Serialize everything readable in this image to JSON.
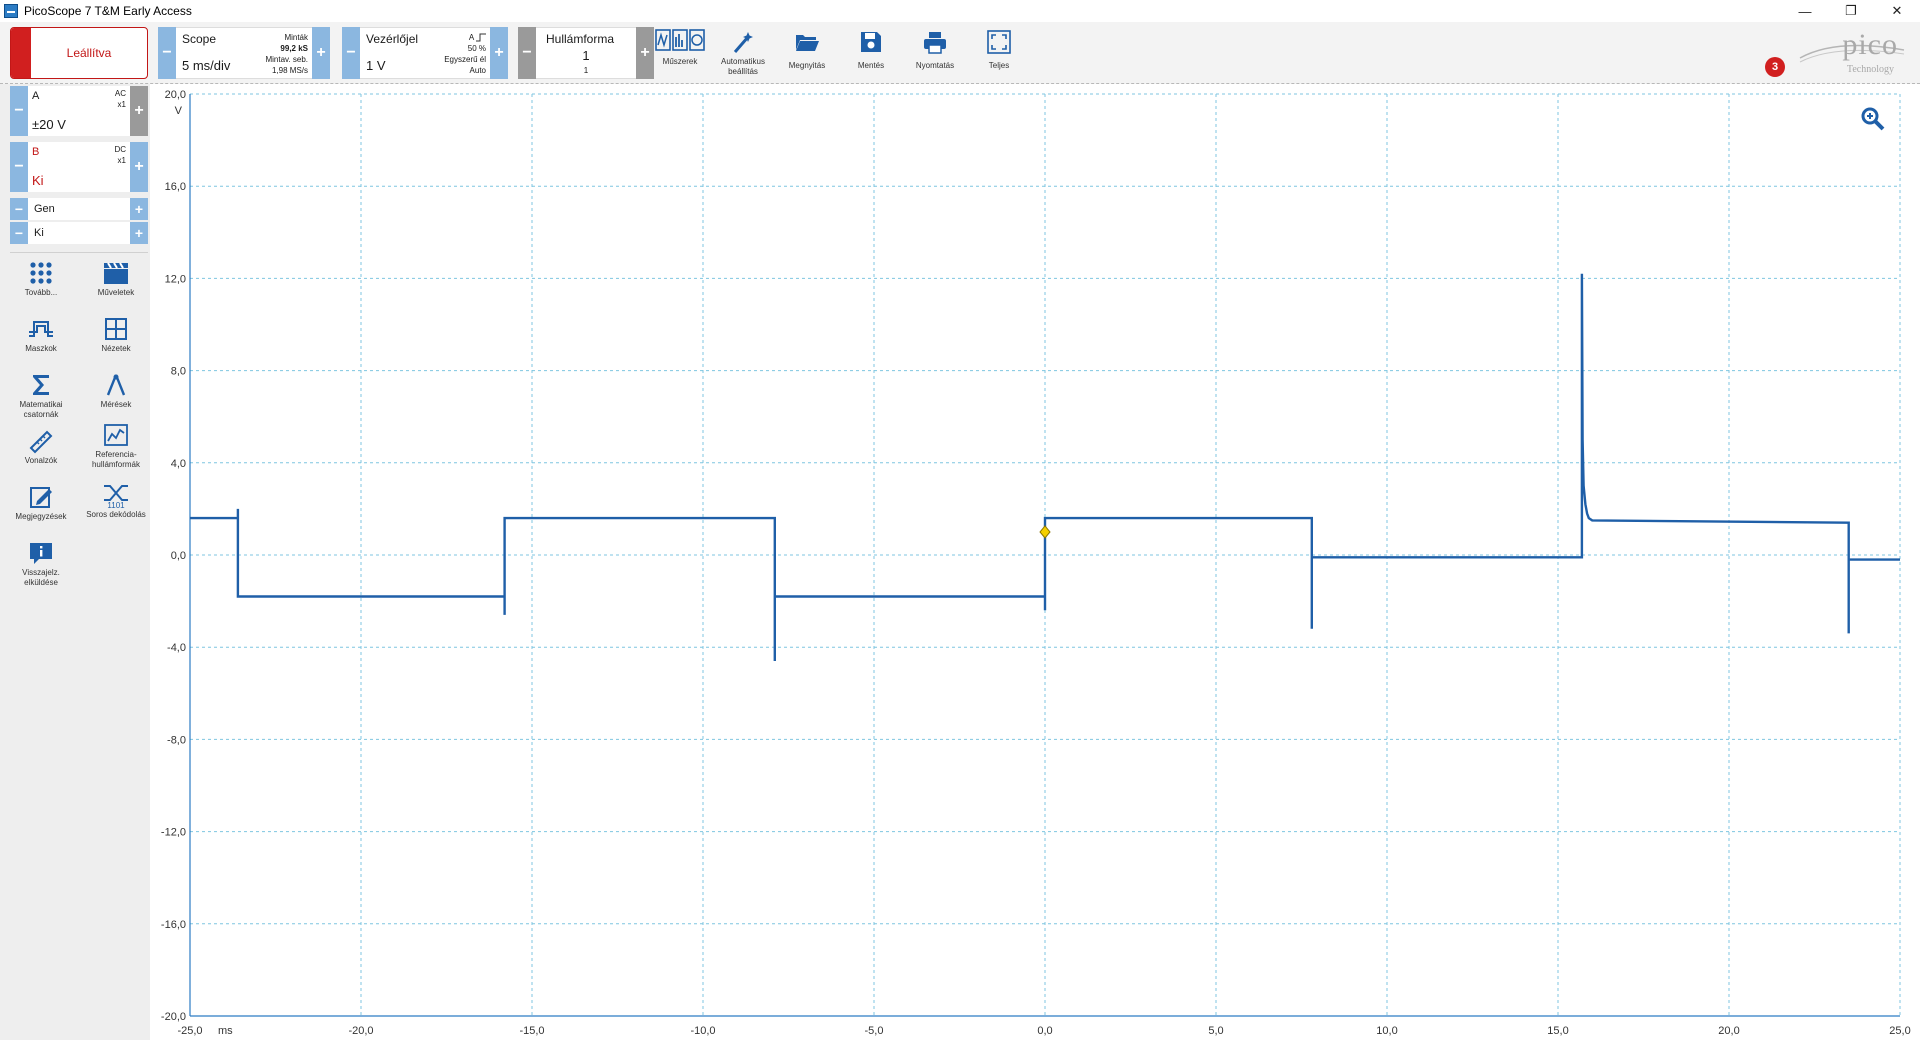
{
  "window": {
    "title": "PicoScope 7 T&M Early Access",
    "minimize": "—",
    "maximize": "❐",
    "close": "✕"
  },
  "toolbar": {
    "run_state": "Leállítva",
    "scope": {
      "title": "Scope",
      "timebase": "5 ms/div",
      "samples_label": "Minták",
      "samples_value": "99,2 kS",
      "rate_label": "Mintav. seb.",
      "rate_value": "1,98 MS/s"
    },
    "trigger": {
      "title": "Vezérlőjel",
      "level": "1 V",
      "source": "A",
      "edge_icon": "rising-edge-icon",
      "percent": "50 %",
      "mode_type": "Egyszerű él",
      "mode": "Auto"
    },
    "waveform": {
      "title": "Hullámforma",
      "index": "1",
      "count": "1"
    },
    "tools": {
      "instruments": "Műszerek",
      "autosetup": "Automatikus beállítás",
      "open": "Megnyitás",
      "save": "Mentés",
      "print": "Nyomtatás",
      "fullscreen": "Teljes"
    },
    "logo": {
      "brand": "pico",
      "sub": "Technology"
    },
    "notification_count": "3"
  },
  "sidebar": {
    "channel_a": {
      "name": "A",
      "coupling": "AC",
      "probe": "x1",
      "range": "±20 V"
    },
    "channel_b": {
      "name": "B",
      "coupling": "DC",
      "probe": "x1",
      "range": "Ki"
    },
    "generator": {
      "name": "Gen",
      "state": "Ki"
    },
    "tools": [
      {
        "label": "Tovább...",
        "icon": "more-dots-icon"
      },
      {
        "label": "Műveletek",
        "icon": "clapperboard-icon"
      },
      {
        "label": "Maszkok",
        "icon": "mask-icon"
      },
      {
        "label": "Nézetek",
        "icon": "views-grid-icon"
      },
      {
        "label": "Matematikai csatornák",
        "icon": "sigma-icon"
      },
      {
        "label": "Mérések",
        "icon": "caliper-icon"
      },
      {
        "label": "Vonalzók",
        "icon": "ruler-icon"
      },
      {
        "label": "Referencia-hullámformák",
        "icon": "reference-waveform-icon"
      },
      {
        "label": "Megjegyzések",
        "icon": "notes-icon"
      },
      {
        "label": "Soros dekódolás",
        "icon": "serial-decode-icon"
      },
      {
        "label": "Visszajelz. elküldése",
        "icon": "feedback-icon"
      }
    ]
  },
  "chart_data": {
    "type": "line",
    "y_unit": "V",
    "x_unit": "ms",
    "xlim": [
      -25,
      25
    ],
    "ylim": [
      -20,
      20
    ],
    "x_ticks": [
      "-25,0",
      "-20,0",
      "-15,0",
      "-10,0",
      "-5,0",
      "0,0",
      "5,0",
      "10,0",
      "15,0",
      "20,0",
      "25,0"
    ],
    "y_ticks": [
      "20,0",
      "16,0",
      "12,0",
      "8,0",
      "4,0",
      "0,0",
      "-4,0",
      "-8,0",
      "-12,0",
      "-16,0",
      "-20,0"
    ],
    "grid": true,
    "trace_color": "#1f5fa8",
    "grid_color": "#7fc6e0",
    "trigger_marker": {
      "x": 0.0,
      "y": 1.0
    },
    "series": [
      {
        "x": [
          -25.0,
          -23.6,
          -23.6,
          -23.6,
          -15.8,
          -15.8,
          -15.8,
          -7.9,
          -7.9,
          -7.9,
          0.0,
          0.0,
          0.0,
          7.8,
          7.8,
          7.8,
          15.7,
          15.7,
          15.72,
          15.75,
          15.8,
          15.85,
          15.9,
          16.0,
          23.5,
          23.5,
          23.5,
          25.0
        ],
        "y": [
          1.6,
          1.6,
          2.0,
          -1.8,
          -1.8,
          -2.6,
          1.6,
          1.6,
          -4.6,
          -1.8,
          -1.8,
          -2.4,
          1.6,
          1.6,
          -3.2,
          -0.1,
          -0.1,
          12.2,
          5.0,
          3.0,
          2.2,
          1.8,
          1.6,
          1.5,
          1.4,
          -3.4,
          -0.2,
          -0.2
        ]
      }
    ]
  }
}
